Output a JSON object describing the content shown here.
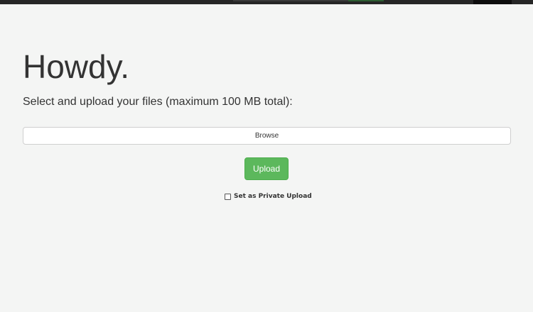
{
  "header": {
    "title": "Howdy."
  },
  "upload_form": {
    "instructions": "Select and upload your files (maximum 100 MB total):",
    "browse_label": "Browse",
    "upload_label": "Upload",
    "private_label": "Set as Private Upload",
    "private_checked": false
  },
  "colors": {
    "background": "#f4f5f4",
    "text": "#333333",
    "upload_button": "#5cb85c",
    "top_bar": "#262626"
  }
}
